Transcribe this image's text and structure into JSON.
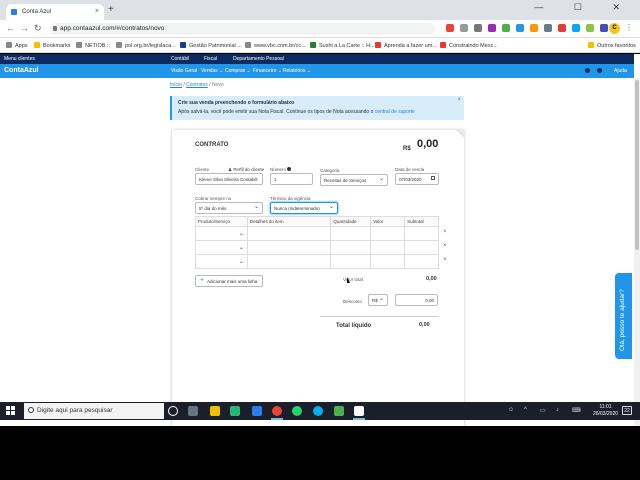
{
  "browser": {
    "tab_title": "Conta Azul",
    "tab_close": "×",
    "new_tab": "+",
    "window_controls": "—  ☐  ✕",
    "url": "app.contaazul.com/#/contratos/novo",
    "profile_letter": "C",
    "bookmarks": [
      "Apps",
      "Bookmarks",
      "NETIOB ::",
      "pol.org.br/legislaca...",
      "Gestão Patrimonial ...",
      "www.vbc.com.br/cc...",
      "Sushi a La Carte :: H...",
      "Aprenda a fazer um...",
      "Constraindo Mexc...",
      "Outros favoritos"
    ]
  },
  "app": {
    "topnav": {
      "left": "Menu clientes",
      "items": [
        "Contábil",
        "Fiscal",
        "Departamento Pessoal"
      ]
    },
    "logo": "ContaAzul",
    "menu": [
      "Visão Geral",
      "Vendas",
      "Compras",
      "Financeiro",
      "Relatórios"
    ],
    "help_link": "Ajuda",
    "breadcrumb": {
      "home": "Início",
      "sep1": " / ",
      "contracts": "Contratos",
      "sep2": " / ",
      "current": "Novo"
    },
    "alert": {
      "title": "Crie sua venda preenchendo o formulário abaixo",
      "text_before": "Após salvá-la, você pode emitir sua Nota Fiscal. Continue os tipos de Nota acessando o",
      "link": "central de suporte",
      "close": "×"
    },
    "contract": {
      "title": "CONTRATO",
      "currency": "R$",
      "total": "0,00",
      "fields": {
        "cliente_label": "Cliente",
        "perfil_label": "Perfil do cliente",
        "cliente_value": "Kleme Silva Silveira Contabili",
        "numero_label": "Número",
        "numero_value": "1",
        "categoria_label": "Categoria",
        "categoria_value": "Receitas de Serviços",
        "data_label": "Data de venda",
        "data_value": "07/03/2020",
        "cobrar_label": "Cobrar sempre no",
        "cobrar_value": "5º dia do mês",
        "termino_label": "Término da vigência",
        "termino_value": "Nunca (indeterminado)"
      },
      "table": {
        "headers": [
          "Produto/Serviço",
          "Detalhes do item",
          "Quantidade",
          "Valor",
          "Subtotal"
        ],
        "row_count": 3,
        "chevron": "⌄",
        "remove": "×"
      },
      "add_items_button": "Adicionar mais uma linha",
      "add_plus": "+",
      "valor_total_label": "Valor total",
      "valor_total_value": "0,00",
      "desconto_label": "Desconto",
      "desconto_type": "R$",
      "desconto_value": "0,00",
      "total_liquido_label": "Total líquido",
      "total_liquido_value": "0,00"
    },
    "help_tab": "Olá, posso te ajudar?"
  },
  "taskbar": {
    "search_placeholder": "Digite aqui para pesquisar",
    "time": "11:01",
    "date": "26/03/2020",
    "notif_count": "22"
  }
}
